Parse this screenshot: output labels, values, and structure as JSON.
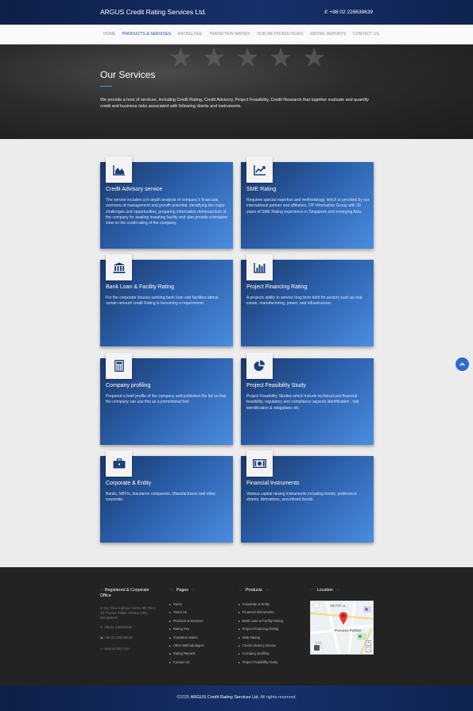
{
  "header": {
    "brand": "ARGUS Credit Rating Services Ltd.",
    "phone": "+88 02 226638639",
    "phone_icon": "phone-icon"
  },
  "nav": {
    "items": [
      {
        "label": "HOME"
      },
      {
        "label": "PRODUCTS & SERVICES",
        "active": true
      },
      {
        "label": "RATING FEE"
      },
      {
        "label": "TRANSITION MATRIX"
      },
      {
        "label": "OUR METHODOLOGIES"
      },
      {
        "label": "RATING REPORTS"
      },
      {
        "label": "CONTACT US"
      }
    ]
  },
  "hero": {
    "title": "Our Services",
    "description": "We provide a host of services, including Credit Rating, Credit Advisory, Project Feasibility, Credit Research that together evaluate and quantify credit and business risks associated with following clients and instruments."
  },
  "services": [
    {
      "icon": "area-chart-icon",
      "title": "Credit Advisory service",
      "text": "The service includes a in depth analysis of company's financials, overview of management and growth potential, identifying the major challenges and opportunities, preparing information memorandum of the company for availing investing facility and also provide a tentative view on the credit rating of the company."
    },
    {
      "icon": "line-chart-icon",
      "title": "SME Rating",
      "text": "Requires special expertise and methodology, which is provided by our international partner and affiliation, DP Information Group with 30 years of SME Rating experience in Singapore and emerging Asia."
    },
    {
      "icon": "bank-icon",
      "title": "Bank Loan & Facility Rating",
      "text": "For the corporate houses seeking bank loan and facilities above certain amount credit Rating is becoming a requirement."
    },
    {
      "icon": "bar-chart-icon",
      "title": "Project Financing Rating",
      "text": "A projects ability to service long term debt for sectors such as real-estate, manufacturing, power, and infrastructure."
    },
    {
      "icon": "calculator-icon",
      "title": "Company profiling",
      "text": "Prepared a brief profile of the company and published the list so that the company can use this as a promotional tool."
    },
    {
      "icon": "pie-chart-icon",
      "title": "Project Feasibility Study",
      "text": "Project Feasibility Studies which include technical and financial feasibility, regulatory and compliance aspects identification , risk identification & mitigations etc."
    },
    {
      "icon": "briefcase-icon",
      "title": "Corporate & Entity",
      "text": "Banks, NBFIs, Insurance companies, Manufacturers and other corporate."
    },
    {
      "icon": "money-icon",
      "title": "Financial Instruments",
      "text": "Various capital raising instruments including bonds, preference shares, derivatives, securitized bonds."
    }
  ],
  "footer": {
    "office": {
      "title_prefix": ":::",
      "title": "Registered & Corporate Office",
      "address": "Sky View Harbour Centre 8th Floor, 3/1 Purana Paltan, Dhaka-1000, Bangladesh.",
      "phone": "+88 02 226638639",
      "fax": "+88 02 226638640",
      "web": "www.arcsbd.com"
    },
    "pages": {
      "title_left": ":::",
      "title": "Pages",
      "title_right": ":::",
      "items": [
        "Home",
        "About Us",
        "Products & Services",
        "Rating Fee",
        "Transition Matrix",
        "Other Methodologies",
        "Rating Reports",
        "Contact Us"
      ]
    },
    "products": {
      "title_left": ":::",
      "title": "Products",
      "title_right": ":::",
      "items": [
        "Corporate & Entity",
        "Financial Instruments",
        "Bank Loan & Facility Rating",
        "Project Financing Rating",
        "SME Rating",
        "Credit Advisory service",
        "Company profiling",
        "Project Feasibility Study"
      ]
    },
    "location": {
      "title_left": ":::",
      "title": "Location",
      "title_right": ":::",
      "map_label_1": "স্কাই ভিউ হে...",
      "map_label_2": "Purana Paltan"
    }
  },
  "copyright": {
    "prefix": "©2025",
    "company": "ARGUS Credit Rating Services Ltd.",
    "suffix": "All rights reserved."
  }
}
